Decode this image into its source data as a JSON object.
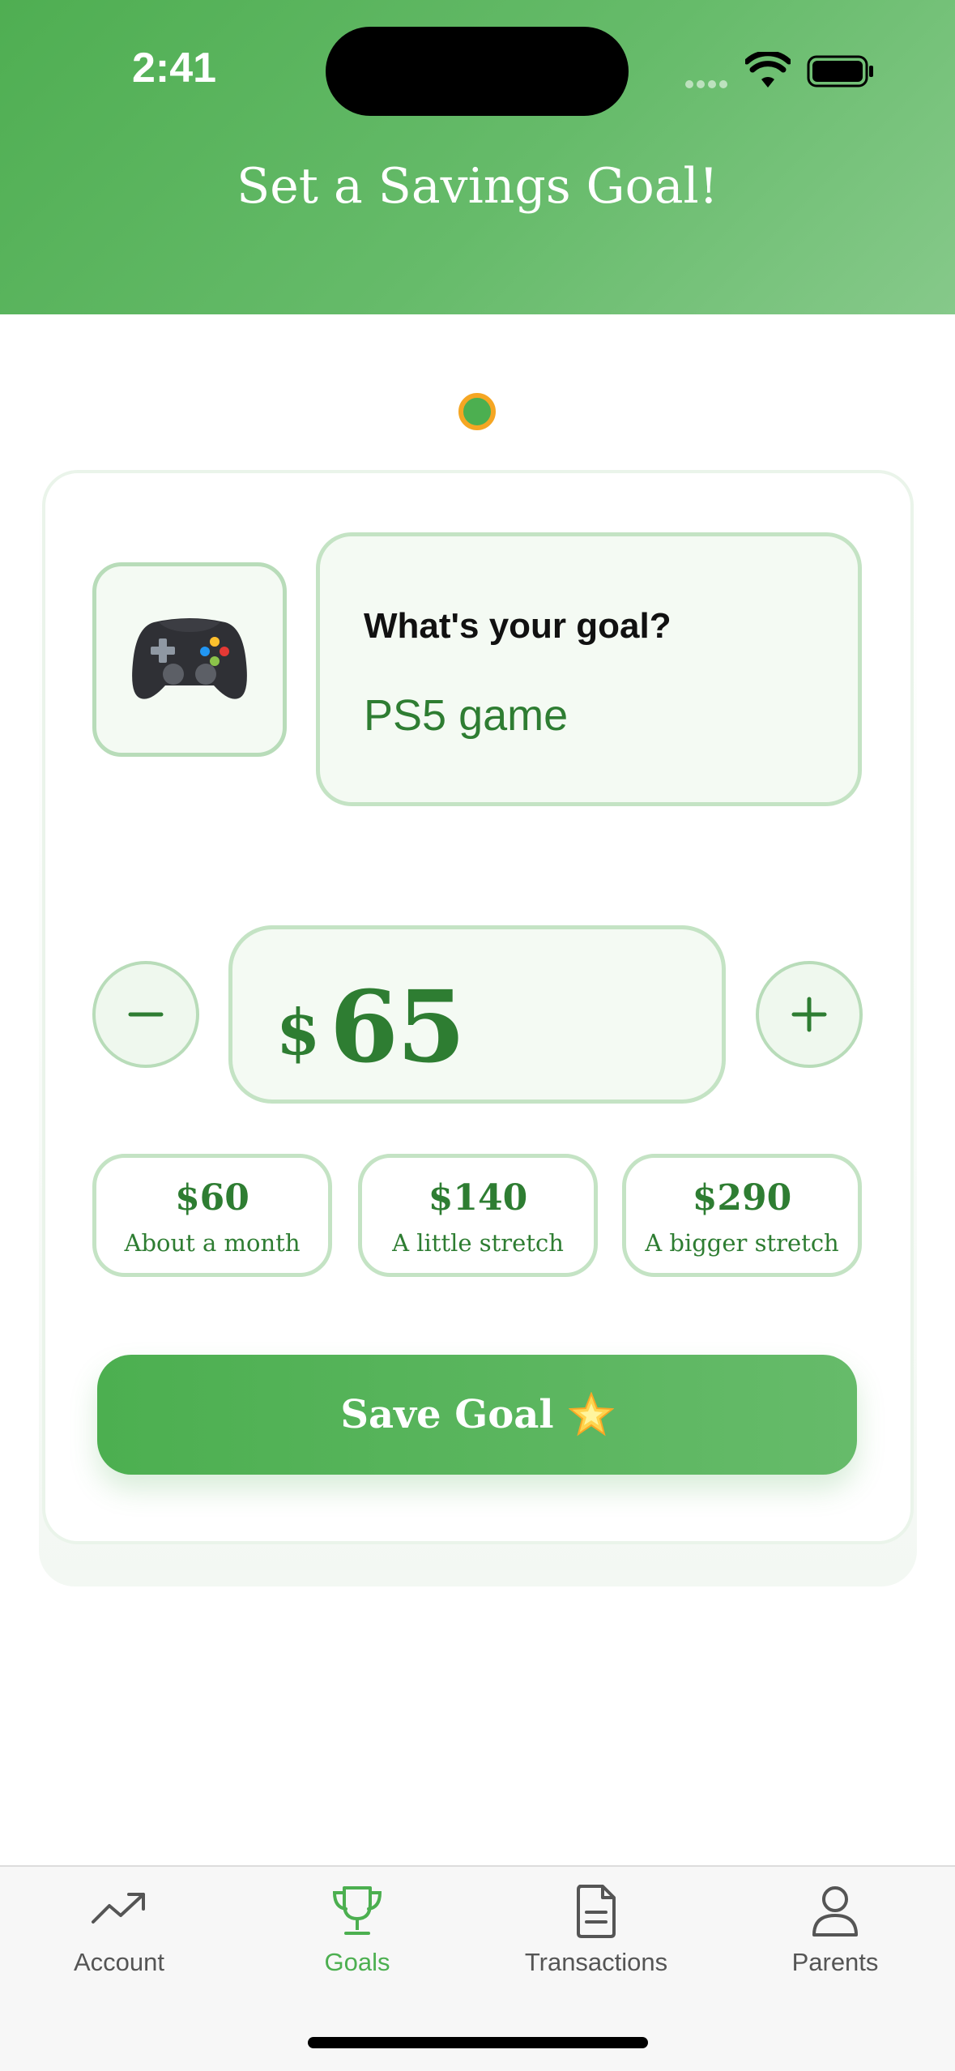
{
  "status_bar": {
    "time": "2:41"
  },
  "header": {
    "title": "Set a Savings Goal!"
  },
  "goal": {
    "icon": "game-controller-icon",
    "label": "What's your goal?",
    "value": "PS5 game"
  },
  "amount": {
    "currency": "$",
    "value": "65",
    "decrement_icon": "minus-icon",
    "increment_icon": "plus-icon"
  },
  "presets": [
    {
      "amount": "$60",
      "caption": "About a month"
    },
    {
      "amount": "$140",
      "caption": "A little stretch"
    },
    {
      "amount": "$290",
      "caption": "A bigger stretch"
    }
  ],
  "save_button": {
    "label": "Save Goal",
    "icon": "star-icon"
  },
  "tabs": [
    {
      "label": "Account",
      "icon": "trending-up-icon",
      "active": false
    },
    {
      "label": "Goals",
      "icon": "trophy-icon",
      "active": true
    },
    {
      "label": "Transactions",
      "icon": "document-icon",
      "active": false
    },
    {
      "label": "Parents",
      "icon": "person-icon",
      "active": false
    }
  ],
  "colors": {
    "accent": "#4caf50",
    "accent_dark": "#2e7d32",
    "progress_ring": "#f5a623"
  }
}
